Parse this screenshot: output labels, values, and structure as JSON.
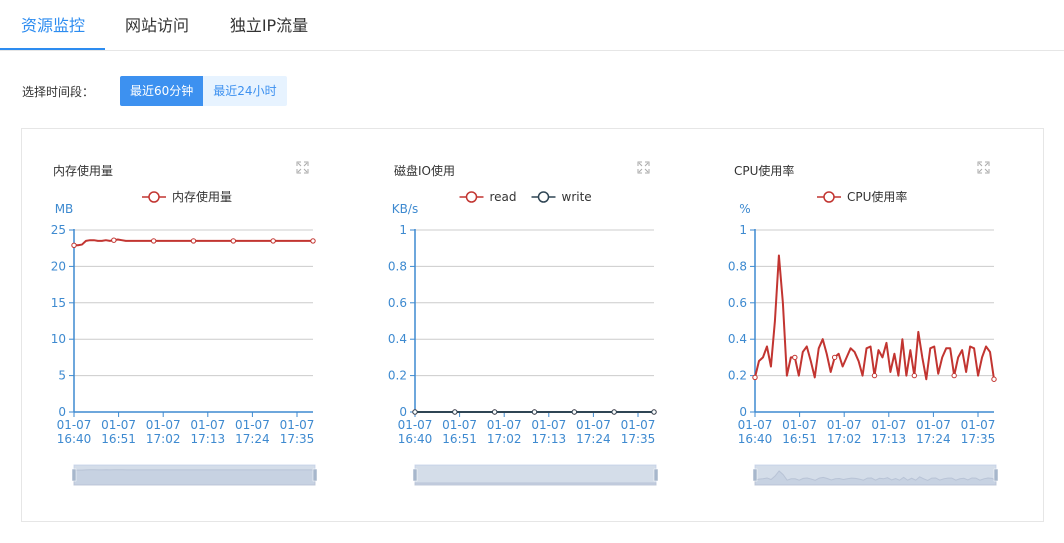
{
  "tabs": [
    {
      "label": "资源监控",
      "active": true
    },
    {
      "label": "网站访问",
      "active": false
    },
    {
      "label": "独立IP流量",
      "active": false
    }
  ],
  "range": {
    "label": "选择时间段：",
    "options": [
      {
        "label": "最近60分钟",
        "active": true
      },
      {
        "label": "最近24小时",
        "active": false
      }
    ]
  },
  "colors": {
    "accent": "#2d8cf0",
    "series_red": "#c23531",
    "series_dark": "#2f4554",
    "axis": "#3e8ad0"
  },
  "chart_data": [
    {
      "type": "line",
      "title": "内存使用量",
      "ylabel": "MB",
      "ylim": [
        0,
        25
      ],
      "yticks": [
        0,
        5,
        10,
        15,
        20,
        25
      ],
      "xticks": [
        {
          "top": "01-07",
          "bottom": "16:40"
        },
        {
          "top": "01-07",
          "bottom": "16:51"
        },
        {
          "top": "01-07",
          "bottom": "17:02"
        },
        {
          "top": "01-07",
          "bottom": "17:13"
        },
        {
          "top": "01-07",
          "bottom": "17:24"
        },
        {
          "top": "01-07",
          "bottom": "17:35"
        }
      ],
      "series": [
        {
          "name": "内存使用量",
          "color": "#c23531",
          "values": [
            22.9,
            22.9,
            23.0,
            23.5,
            23.6,
            23.6,
            23.5,
            23.5,
            23.6,
            23.5,
            23.6,
            23.7,
            23.6,
            23.5,
            23.5,
            23.5,
            23.5,
            23.5,
            23.5,
            23.5,
            23.5,
            23.5,
            23.5,
            23.5,
            23.5,
            23.5,
            23.5,
            23.5,
            23.5,
            23.5,
            23.5,
            23.5,
            23.5,
            23.5,
            23.5,
            23.5,
            23.5,
            23.5,
            23.5,
            23.5,
            23.5,
            23.5,
            23.5,
            23.5,
            23.5,
            23.5,
            23.5,
            23.5,
            23.5,
            23.5,
            23.5,
            23.5,
            23.5,
            23.5,
            23.5,
            23.5,
            23.5,
            23.5,
            23.5,
            23.5,
            23.5
          ]
        }
      ]
    },
    {
      "type": "line",
      "title": "磁盘IO使用",
      "ylabel": "KB/s",
      "ylim": [
        0,
        1
      ],
      "yticks": [
        0,
        0.2,
        0.4,
        0.6,
        0.8,
        1
      ],
      "xticks": [
        {
          "top": "01-07",
          "bottom": "16:40"
        },
        {
          "top": "01-07",
          "bottom": "16:51"
        },
        {
          "top": "01-07",
          "bottom": "17:02"
        },
        {
          "top": "01-07",
          "bottom": "17:13"
        },
        {
          "top": "01-07",
          "bottom": "17:24"
        },
        {
          "top": "01-07",
          "bottom": "17:35"
        }
      ],
      "series": [
        {
          "name": "read",
          "color": "#c23531",
          "values": [
            0,
            0,
            0,
            0,
            0,
            0,
            0,
            0,
            0,
            0,
            0,
            0,
            0,
            0,
            0,
            0,
            0,
            0,
            0,
            0,
            0,
            0,
            0,
            0,
            0,
            0,
            0,
            0,
            0,
            0,
            0,
            0,
            0,
            0,
            0,
            0,
            0,
            0,
            0,
            0,
            0,
            0,
            0,
            0,
            0,
            0,
            0,
            0,
            0,
            0,
            0,
            0,
            0,
            0,
            0,
            0,
            0,
            0,
            0,
            0,
            0
          ]
        },
        {
          "name": "write",
          "color": "#2f4554",
          "values": [
            0,
            0,
            0,
            0,
            0,
            0,
            0,
            0,
            0,
            0,
            0,
            0,
            0,
            0,
            0,
            0,
            0,
            0,
            0,
            0,
            0,
            0,
            0,
            0,
            0,
            0,
            0,
            0,
            0,
            0,
            0,
            0,
            0,
            0,
            0,
            0,
            0,
            0,
            0,
            0,
            0,
            0,
            0,
            0,
            0,
            0,
            0,
            0,
            0,
            0,
            0,
            0,
            0,
            0,
            0,
            0,
            0,
            0,
            0,
            0,
            0
          ]
        }
      ]
    },
    {
      "type": "line",
      "title": "CPU使用率",
      "ylabel": "%",
      "ylim": [
        0,
        1
      ],
      "yticks": [
        0,
        0.2,
        0.4,
        0.6,
        0.8,
        1
      ],
      "xticks": [
        {
          "top": "01-07",
          "bottom": "16:40"
        },
        {
          "top": "01-07",
          "bottom": "16:51"
        },
        {
          "top": "01-07",
          "bottom": "17:02"
        },
        {
          "top": "01-07",
          "bottom": "17:13"
        },
        {
          "top": "01-07",
          "bottom": "17:24"
        },
        {
          "top": "01-07",
          "bottom": "17:35"
        }
      ],
      "series": [
        {
          "name": "CPU使用率",
          "color": "#c23531",
          "values": [
            0.19,
            0.28,
            0.3,
            0.36,
            0.25,
            0.5,
            0.86,
            0.6,
            0.2,
            0.3,
            0.3,
            0.2,
            0.33,
            0.36,
            0.28,
            0.19,
            0.35,
            0.4,
            0.32,
            0.22,
            0.3,
            0.32,
            0.25,
            0.3,
            0.35,
            0.33,
            0.28,
            0.2,
            0.35,
            0.36,
            0.2,
            0.34,
            0.3,
            0.38,
            0.22,
            0.32,
            0.2,
            0.4,
            0.2,
            0.34,
            0.2,
            0.44,
            0.3,
            0.18,
            0.35,
            0.36,
            0.21,
            0.3,
            0.35,
            0.35,
            0.2,
            0.3,
            0.34,
            0.22,
            0.36,
            0.35,
            0.2,
            0.3,
            0.36,
            0.33,
            0.18
          ]
        }
      ]
    }
  ]
}
